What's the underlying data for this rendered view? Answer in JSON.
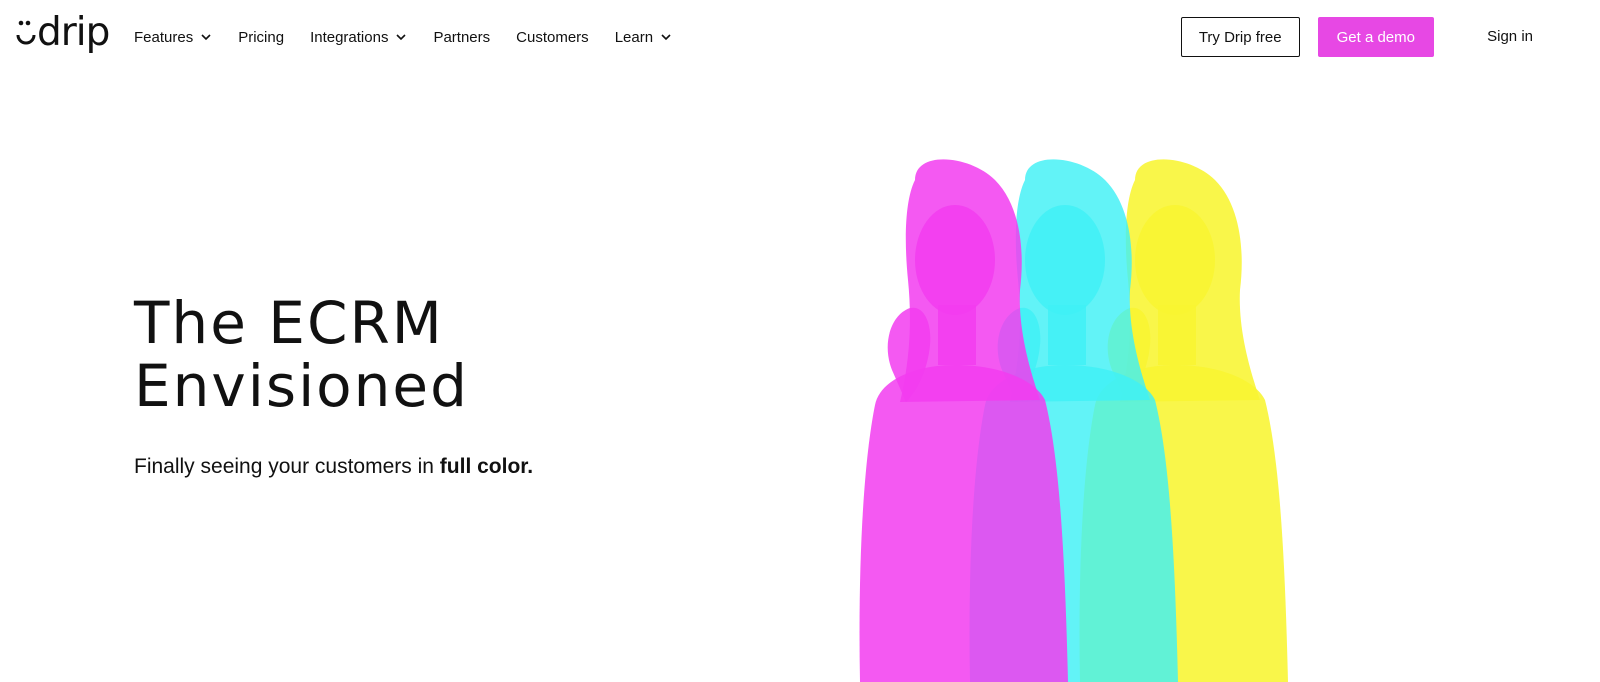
{
  "brand": {
    "name": "drip",
    "accent": "#e748e4"
  },
  "nav": {
    "items": [
      {
        "label": "Features",
        "has_dropdown": true
      },
      {
        "label": "Pricing",
        "has_dropdown": false
      },
      {
        "label": "Integrations",
        "has_dropdown": true
      },
      {
        "label": "Partners",
        "has_dropdown": false
      },
      {
        "label": "Customers",
        "has_dropdown": false
      },
      {
        "label": "Learn",
        "has_dropdown": true
      }
    ]
  },
  "actions": {
    "try_label": "Try Drip free",
    "demo_label": "Get a demo",
    "sign_in_label": "Sign in"
  },
  "hero": {
    "title_line1": "The ECRM",
    "title_line2": "Envisioned",
    "subtitle_prefix": "Finally seeing your customers in ",
    "subtitle_bold": "full color."
  },
  "art": {
    "colors": [
      "#f23cf0",
      "#3ff0f5",
      "#f8f531"
    ],
    "icon": "woman-silhouette-triptych"
  }
}
